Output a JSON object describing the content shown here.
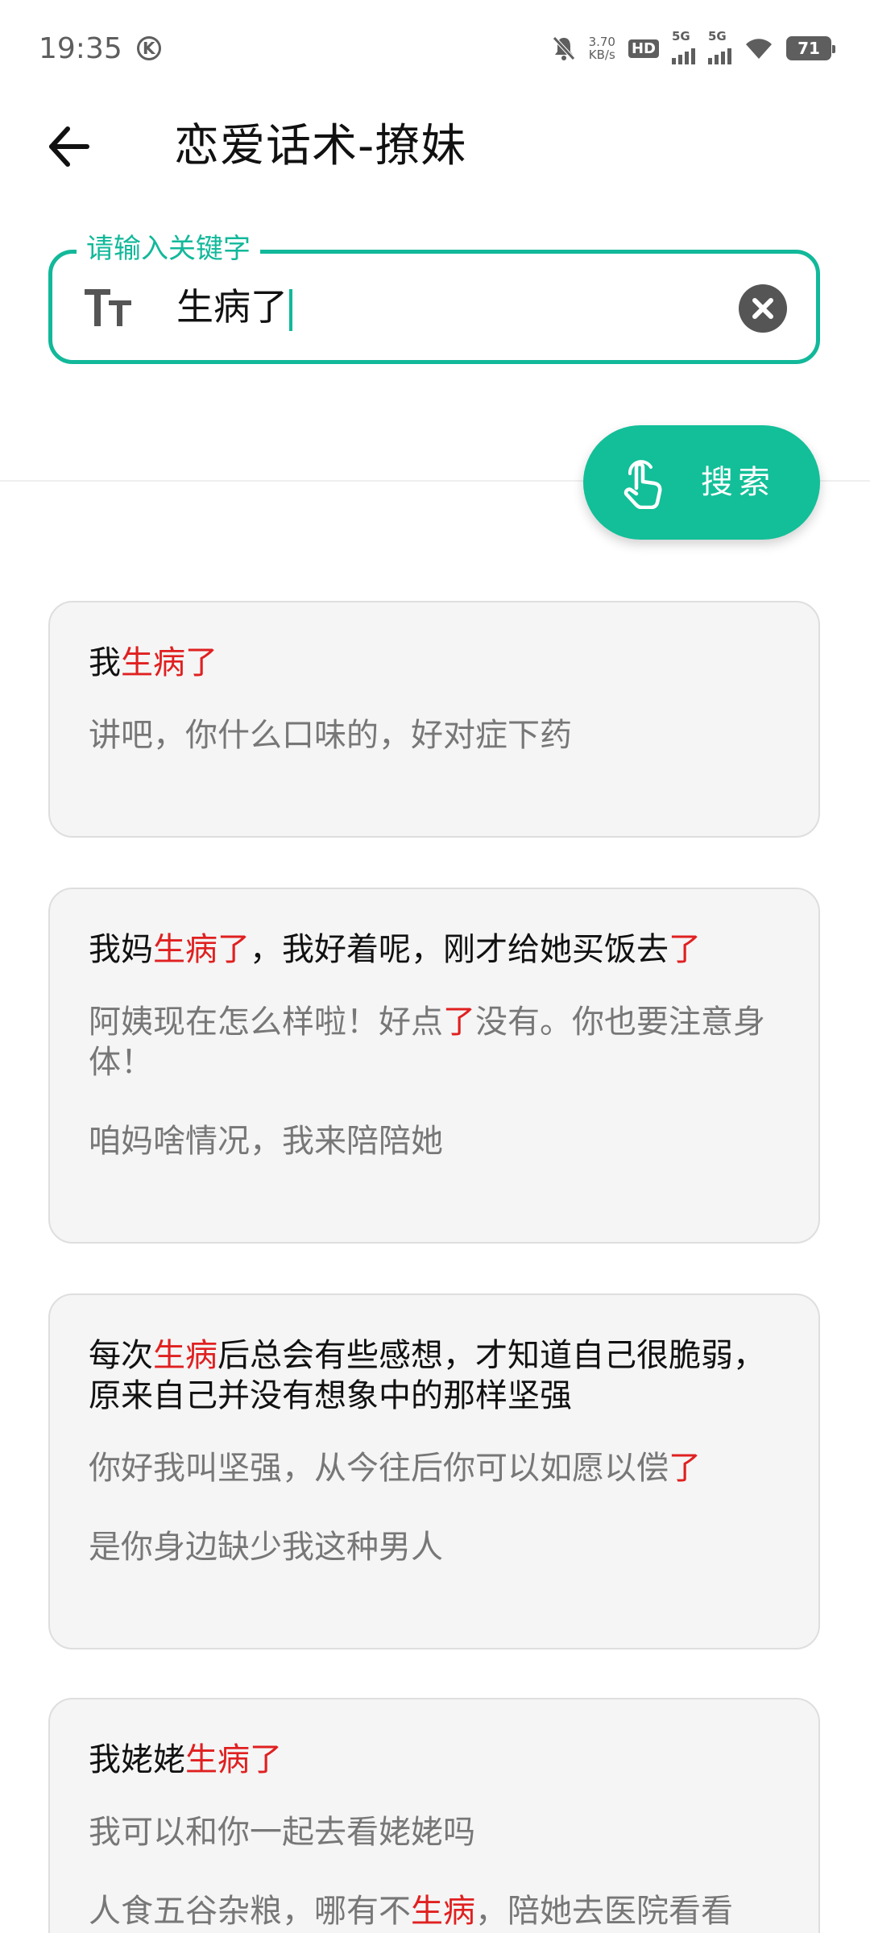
{
  "status_bar": {
    "time": "19:35",
    "net_speed_value": "3.70",
    "net_speed_unit": "KB/s",
    "hd_label": "HD",
    "sim1_label": "5G",
    "sim2_label": "5G",
    "battery": "71"
  },
  "header": {
    "title": "恋爱话术-撩妹"
  },
  "search": {
    "legend": "请输入关键字",
    "value": "生病了",
    "button_label": "搜索",
    "accent_color": "#12b89a"
  },
  "results": [
    {
      "title": [
        "我",
        "生病了",
        ""
      ],
      "replies": [
        [
          "讲吧，你什么口味的，好对症下药"
        ]
      ]
    },
    {
      "title": [
        "我妈",
        "生病了",
        "，我好着呢，刚才给她买饭去",
        "了",
        ""
      ],
      "replies": [
        [
          "阿姨现在怎么样啦！好点",
          "了",
          "没有。你也要注意身体！"
        ],
        [
          "咱妈啥情况，我来陪陪她"
        ]
      ]
    },
    {
      "title": [
        "每次",
        "生病",
        "后总会有些感想，才知道自己很脆弱，原来自己并没有想象中的那样坚强"
      ],
      "replies": [
        [
          "你好我叫坚强，从今往后你可以如愿以偿",
          "了",
          ""
        ],
        [
          "是你身边缺少我这种男人"
        ]
      ]
    },
    {
      "title": [
        "我姥姥",
        "生病了",
        ""
      ],
      "replies": [
        [
          "我可以和你一起去看姥姥吗"
        ],
        [
          "人食五谷杂粮，哪有不",
          "生病",
          "，陪她去医院看看"
        ]
      ]
    }
  ],
  "highlight_color": "#e02020"
}
